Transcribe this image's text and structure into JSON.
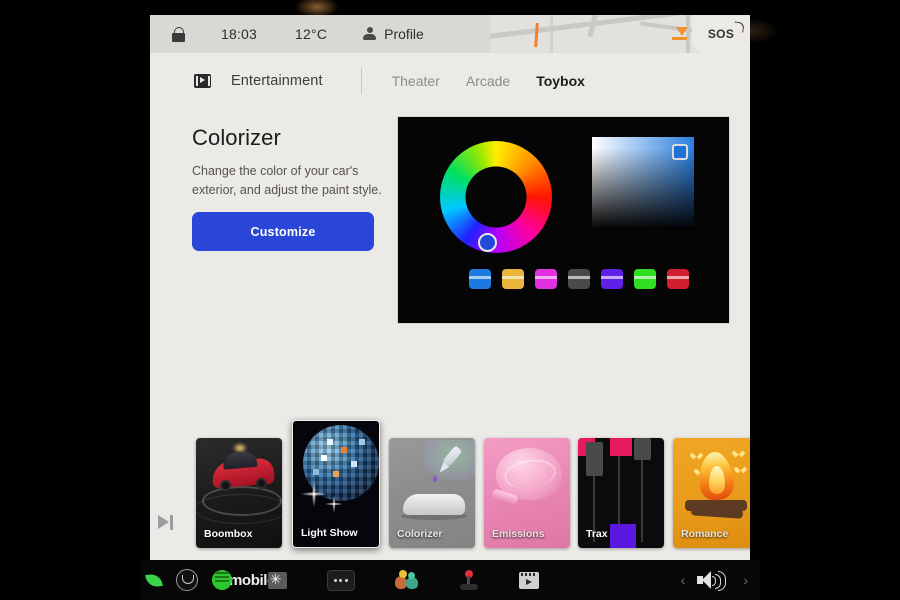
{
  "statusbar": {
    "lock_icon": "lock-icon",
    "time": "18:03",
    "temperature": "12°C",
    "profile_icon": "person-icon",
    "profile_label": "Profile",
    "sos_label": "SOS",
    "map_pin_icon": "map-pin-icon"
  },
  "tabbar": {
    "brand_icon": "film-strip-icon",
    "brand_label": "Entertainment",
    "tabs": [
      {
        "label": "Theater",
        "active": false
      },
      {
        "label": "Arcade",
        "active": false
      },
      {
        "label": "Toybox",
        "active": true
      }
    ]
  },
  "feature": {
    "title": "Colorizer",
    "description": "Change the color of your car's exterior, and adjust the paint style.",
    "button_label": "Customize",
    "button_color": "#2a46d8",
    "preview": {
      "wheel_icon": "hue-wheel",
      "wheel_handle_color": "#2349d8",
      "gradient_icon": "saturation-brightness-square",
      "gradient_handle_color": "#1e6fd8",
      "swatches": [
        {
          "name": "blue",
          "color": "#1a7ae0"
        },
        {
          "name": "gold",
          "color": "#e8b53a"
        },
        {
          "name": "magenta",
          "color": "#e030e0"
        },
        {
          "name": "graphite",
          "color": "#4a4a4a"
        },
        {
          "name": "purple",
          "color": "#6020e8"
        },
        {
          "name": "green",
          "color": "#30e020"
        },
        {
          "name": "red",
          "color": "#d02030"
        }
      ]
    }
  },
  "carousel": {
    "cards": [
      {
        "label": "Boombox",
        "art": "boombox",
        "raised": false
      },
      {
        "label": "Light Show",
        "art": "lightshow",
        "raised": true
      },
      {
        "label": "Colorizer",
        "art": "colorizer",
        "raised": false
      },
      {
        "label": "Emissions",
        "art": "emissions",
        "raised": false
      },
      {
        "label": "Trax",
        "art": "trax",
        "raised": false
      },
      {
        "label": "Romance",
        "art": "romance",
        "raised": false
      }
    ]
  },
  "media_control": {
    "skip_icon": "skip-next-icon"
  },
  "dock": {
    "items": [
      {
        "name": "leaf-icon"
      },
      {
        "name": "circle-u-icon"
      },
      {
        "name": "mobilo-logo",
        "label": "mobilo"
      },
      {
        "name": "more-dots-icon"
      },
      {
        "name": "people-icon"
      },
      {
        "name": "joystick-icon"
      },
      {
        "name": "media-clapper-icon"
      }
    ],
    "prev_label": "‹",
    "next_label": "›",
    "volume_icon": "volume-speaker-icon"
  }
}
